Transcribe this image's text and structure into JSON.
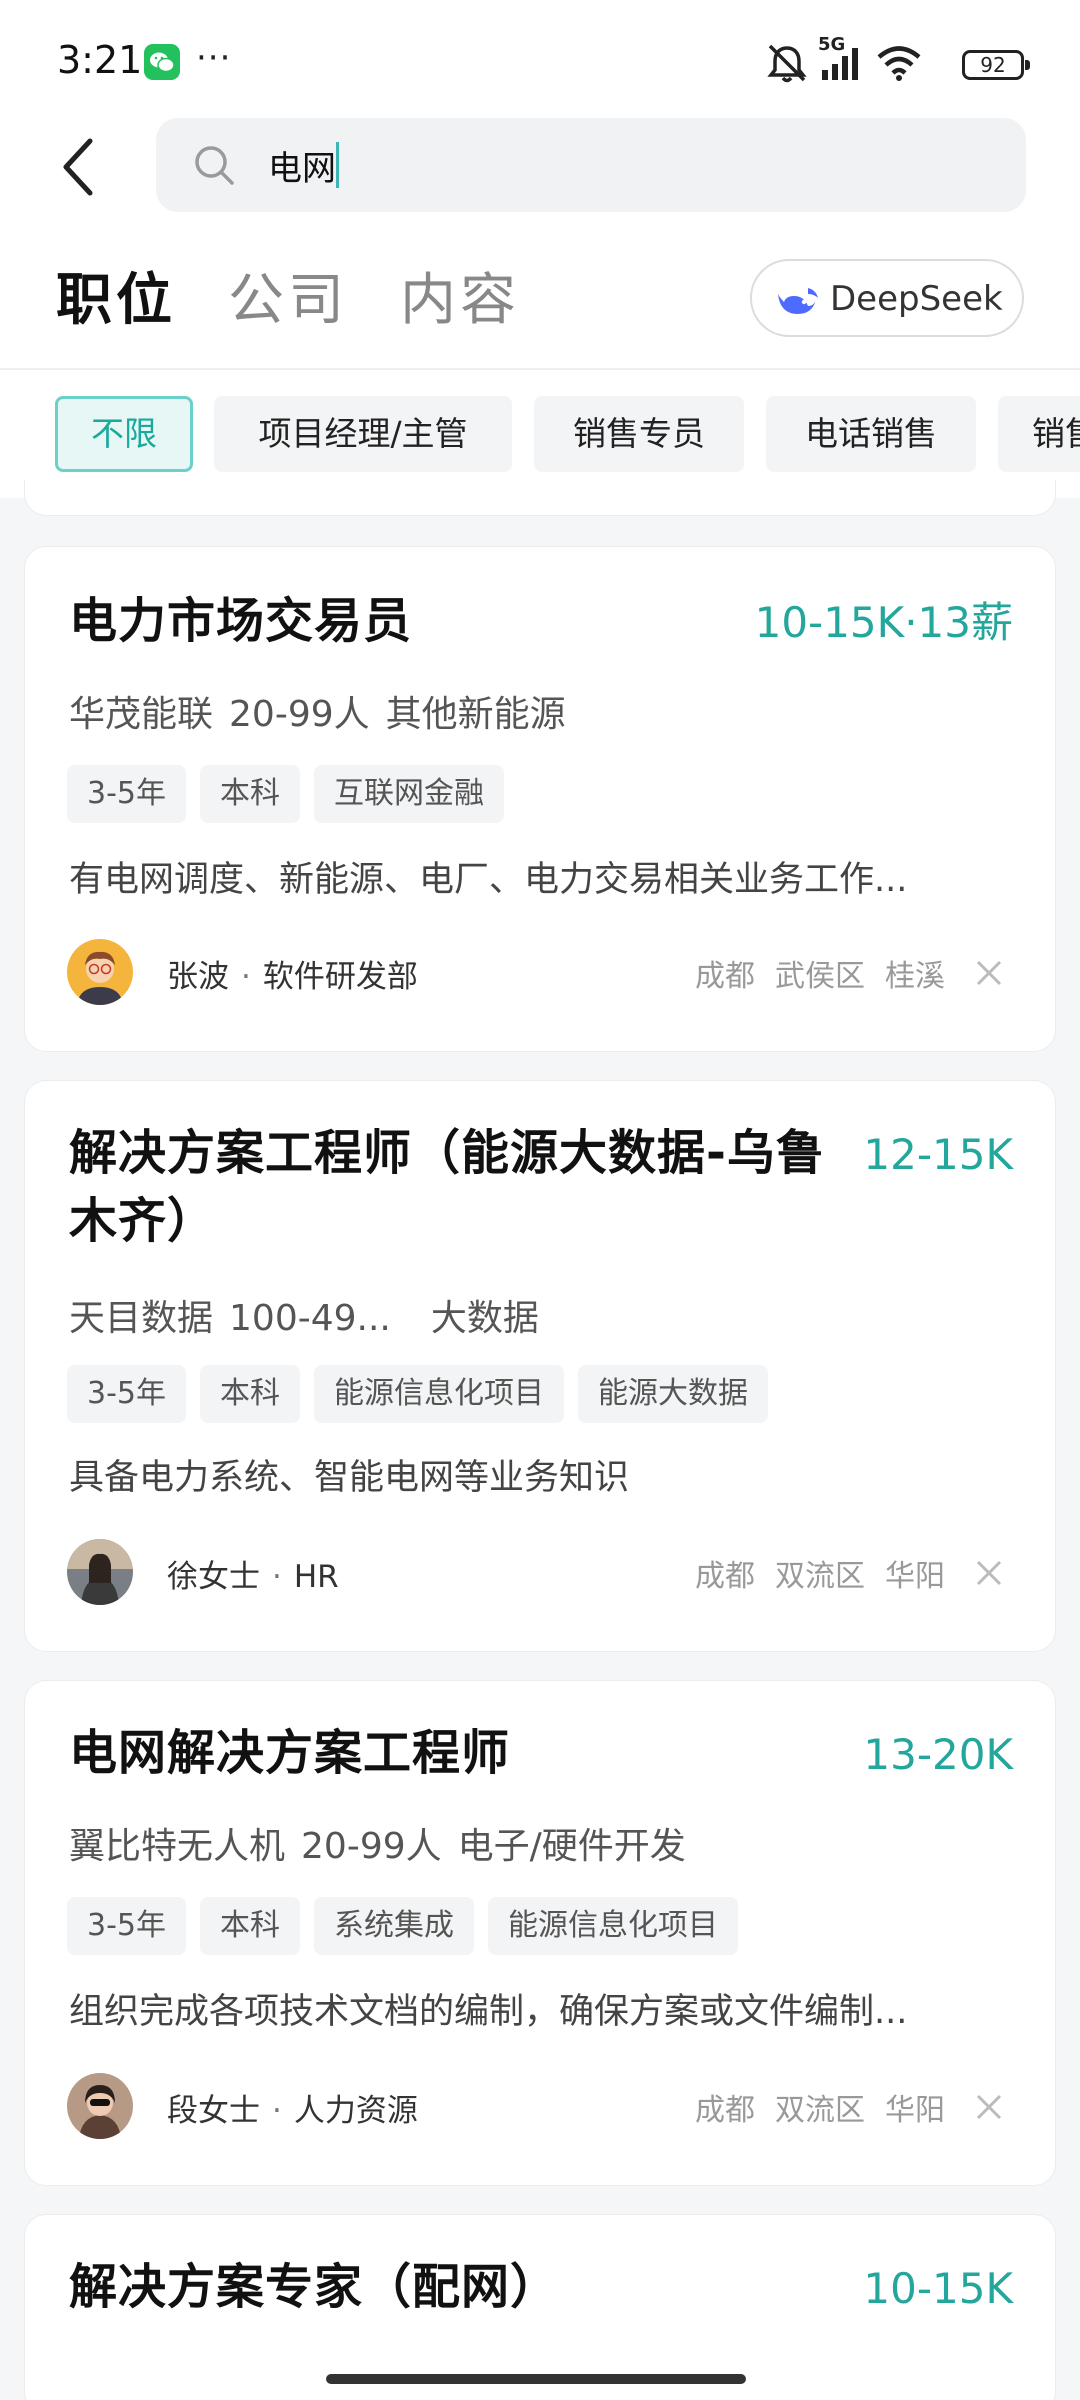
{
  "status_bar": {
    "time": "3:21",
    "more": "···",
    "network": "5G",
    "battery": "92"
  },
  "search": {
    "value": "电网",
    "placeholder": ""
  },
  "tabs": [
    {
      "label": "职位",
      "active": true
    },
    {
      "label": "公司",
      "active": false
    },
    {
      "label": "内容",
      "active": false
    }
  ],
  "deepseek": {
    "label": "DeepSeek"
  },
  "filters": [
    {
      "label": "不限",
      "active": true
    },
    {
      "label": "项目经理/主管",
      "active": false
    },
    {
      "label": "销售专员",
      "active": false
    },
    {
      "label": "电话销售",
      "active": false
    },
    {
      "label": "销售",
      "active": false
    }
  ],
  "jobs": [
    {
      "title_line1": "电力市场交易员",
      "title_line2": "",
      "salary": "10-15K·13薪",
      "company": "华茂能联",
      "size": "20-99人",
      "industry": "其他新能源",
      "tags": [
        "3-5年",
        "本科",
        "互联网金融"
      ],
      "desc": "有电网调度、新能源、电厂、电力交易相关业务工作...",
      "recruiter_name": "张波",
      "recruiter_role": "软件研发部",
      "city": "成都",
      "district": "武侯区",
      "area": "桂溪"
    },
    {
      "title_line1": "解决方案工程师（能源大数据-乌鲁",
      "title_line2": "木齐）",
      "salary": "12-15K",
      "company": "天目数据",
      "size": "100-49...",
      "industry": "大数据",
      "tags": [
        "3-5年",
        "本科",
        "能源信息化项目",
        "能源大数据"
      ],
      "desc": "具备电力系统、智能电网等业务知识",
      "recruiter_name": "徐女士",
      "recruiter_role": "HR",
      "city": "成都",
      "district": "双流区",
      "area": "华阳"
    },
    {
      "title_line1": "电网解决方案工程师",
      "title_line2": "",
      "salary": "13-20K",
      "company": "翼比特无人机",
      "size": "20-99人",
      "industry": "电子/硬件开发",
      "tags": [
        "3-5年",
        "本科",
        "系统集成",
        "能源信息化项目"
      ],
      "desc": "组织完成各项技术文档的编制，确保方案或文件编制...",
      "recruiter_name": "段女士",
      "recruiter_role": "人力资源",
      "city": "成都",
      "district": "双流区",
      "area": "华阳"
    },
    {
      "title_line1": "解决方案专家（配网）",
      "title_line2": "",
      "salary": "10-15K"
    }
  ],
  "colors": {
    "accent": "#23a69c",
    "chip_active_bg": "#e7f7f6",
    "chip_active_border": "#6cd0ca",
    "wechat_green": "#22c15e",
    "deepseek_blue": "#4d6bfe"
  },
  "icons": [
    "back-arrow-icon",
    "search-icon",
    "wechat-icon",
    "mute-icon",
    "signal-icon",
    "wifi-icon",
    "battery-icon",
    "deepseek-whale-icon",
    "close-icon"
  ]
}
